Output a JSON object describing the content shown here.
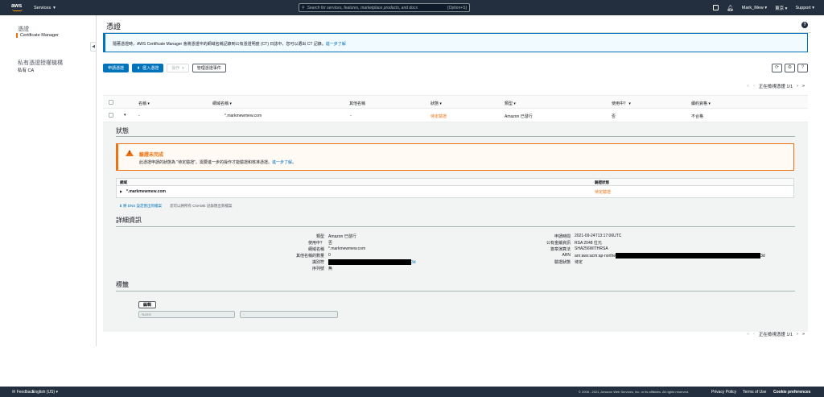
{
  "topbar": {
    "logo": "aws",
    "services": "Services",
    "search_placeholder": "Search for services, features, marketplace products, and docs",
    "search_shortcut": "[Option+S]",
    "user": "Mark_Mew",
    "region": "東京",
    "support": "Support"
  },
  "sidebar": {
    "section1_title": "憑證",
    "section1_item": "Certificate Manager",
    "section2_title": "私有憑證授權機構",
    "section2_item": "私有 CA"
  },
  "page": {
    "title": "憑證",
    "info_text": "隨著憑證時，AWS Certificate Manager 會將憑證中的網域名稱記錄到公有憑證明度 (CT) 日誌中，您可以選出 CT 記錄。",
    "info_link": "進一步了解",
    "buttons": {
      "request": "申請憑證",
      "import": "匯入憑證",
      "actions": "操作",
      "manage_events": "管理憑證事件"
    },
    "pager_text": "正在檢視憑證 1/1"
  },
  "table": {
    "columns": [
      "名稱",
      "網域名稱",
      "其他名稱",
      "狀態",
      "類型",
      "使用中？",
      "續約資格"
    ],
    "row": {
      "name": "-",
      "domain": "*.markmewmew.com",
      "other": "-",
      "status": "待定驗證",
      "type": "Amazon 已發行",
      "in_use": "否",
      "renewal": "不合格"
    }
  },
  "detail": {
    "status_title": "狀態",
    "warn_title": "驗證未完成",
    "warn_text": "此憑證申請的狀態為 \"待定驗證\"。需要進一步的操作才能驗證和核准憑證。",
    "warn_link": "進一步了解",
    "domain_header": "網域",
    "validation_header": "驗證狀態",
    "domain_value": "*.markmewmew.com",
    "validation_value": "待定驗證",
    "export_link": "將 DNS 設定匯出到檔案",
    "export_note": "您可以將所有 CNAME 記錄匯出到檔案",
    "details_title": "詳細資訊",
    "left": [
      {
        "k": "類型",
        "v": "Amazon 已發行"
      },
      {
        "k": "使用中？",
        "v": "否"
      },
      {
        "k": "網域名稱",
        "v": "*.markmewmew.com"
      },
      {
        "k": "其他名稱的數量",
        "v": "0"
      },
      {
        "k": "識別符",
        "v": "3d"
      },
      {
        "k": "序列號",
        "v": "無"
      }
    ],
    "right": [
      {
        "k": "申請時間",
        "v": "2021-09-24T13:17:06UTC"
      },
      {
        "k": "公有金鑰資訊",
        "v": "RSA 2048 位元"
      },
      {
        "k": "簽章演算法",
        "v": "SHA256WITHRSA"
      },
      {
        "k": "ARN",
        "v": "arn:aws:acm:ap-northe",
        "v2": "3d"
      },
      {
        "k": "驗證狀態",
        "v": "待定"
      }
    ],
    "tags_title": "標籤",
    "edit_button": "編輯",
    "tag_name_placeholder": "Name",
    "tag_value_placeholder": "-"
  },
  "footer": {
    "feedback": "Feedback",
    "language": "English (US)",
    "copyright": "© 2008 - 2021, Amazon Web Services, Inc. or its affiliates. All rights reserved.",
    "privacy": "Privacy Policy",
    "terms": "Terms of Use",
    "cookies": "Cookie preferences"
  }
}
